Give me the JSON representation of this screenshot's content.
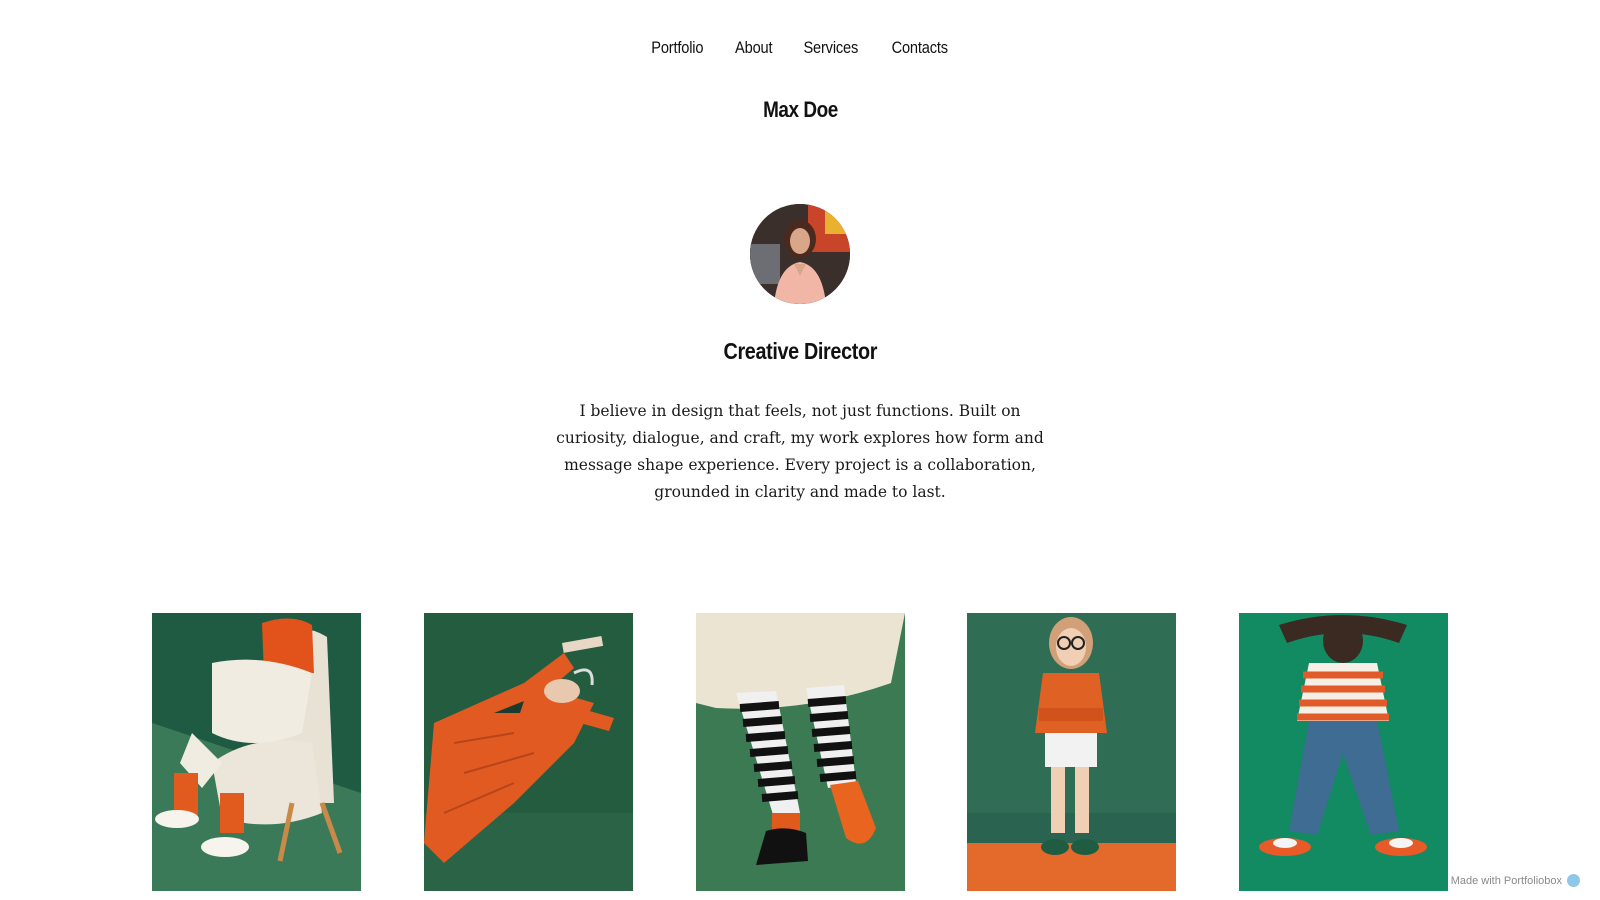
{
  "nav": {
    "items": [
      {
        "label": "Portfolio"
      },
      {
        "label": "About"
      },
      {
        "label": "Services"
      },
      {
        "label": "Contacts"
      }
    ]
  },
  "site": {
    "name": "Max Doe"
  },
  "profile": {
    "avatar_icon": "avatar-portrait",
    "role": "Creative Director",
    "bio": "I believe in design that feels, not just functions. Built on curiosity, dialogue, and craft, my work explores how form and message shape experience. Every project is a collaboration, grounded in clarity and made to last."
  },
  "gallery": {
    "items": [
      {
        "subject": "figure-in-armchair",
        "colors": [
          "#2c6b4f",
          "#e25a1f",
          "#f1ece2"
        ]
      },
      {
        "subject": "man-lying-down",
        "colors": [
          "#245e40",
          "#e15c22",
          "#e8d7c4"
        ]
      },
      {
        "subject": "striped-legs",
        "colors": [
          "#3b7a52",
          "#111111",
          "#f0f0f0"
        ]
      },
      {
        "subject": "girl-with-glasses",
        "colors": [
          "#2f7a5d",
          "#e46424",
          "#f2f2f2"
        ]
      },
      {
        "subject": "boy-hands-behind-head",
        "colors": [
          "#148a63",
          "#e05a2a",
          "#3e6c93"
        ]
      }
    ]
  },
  "footer": {
    "badge": "Made with Portfoliobox"
  }
}
